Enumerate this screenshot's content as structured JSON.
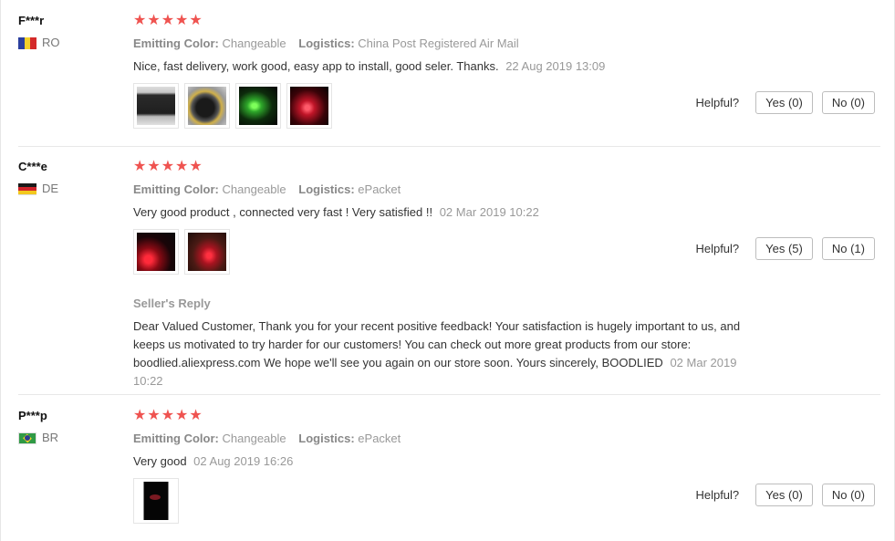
{
  "reviews": [
    {
      "username": "F***r",
      "country": "RO",
      "rating_stars": 5,
      "attrs": {
        "color_label": "Emitting Color:",
        "color_value": "Changeable",
        "logistics_label": "Logistics:",
        "logistics_value": "China Post Registered Air Mail"
      },
      "text": "Nice, fast delivery, work good, easy app to install, good seler. Thanks.",
      "date": "22 Aug 2019 13:09",
      "helpful_label": "Helpful?",
      "yes_label": "Yes (0)",
      "no_label": "No (0)"
    },
    {
      "username": "C***e",
      "country": "DE",
      "rating_stars": 5,
      "attrs": {
        "color_label": "Emitting Color:",
        "color_value": "Changeable",
        "logistics_label": "Logistics:",
        "logistics_value": "ePacket"
      },
      "text": "Very good product , connected very fast ! Very satisfied !!",
      "date": "02 Mar 2019 10:22",
      "helpful_label": "Helpful?",
      "yes_label": "Yes (5)",
      "no_label": "No (1)",
      "reply": {
        "title": "Seller's Reply",
        "text": "Dear Valued Customer, Thank you for your recent positive feedback! Your satisfaction is hugely important to us, and keeps us motivated to try harder for our customers! You can check out more great products from our store: boodlied.aliexpress.com We hope we'll see you again on our store soon. Yours sincerely, BOODLIED",
        "date": "02 Mar 2019 10:22"
      }
    },
    {
      "username": "P***p",
      "country": "BR",
      "rating_stars": 5,
      "attrs": {
        "color_label": "Emitting Color:",
        "color_value": "Changeable",
        "logistics_label": "Logistics:",
        "logistics_value": "ePacket"
      },
      "text": "Very good",
      "date": "02 Aug 2019 16:26",
      "helpful_label": "Helpful?",
      "yes_label": "Yes (0)",
      "no_label": "No (0)"
    }
  ],
  "star_color": "#ef5350"
}
